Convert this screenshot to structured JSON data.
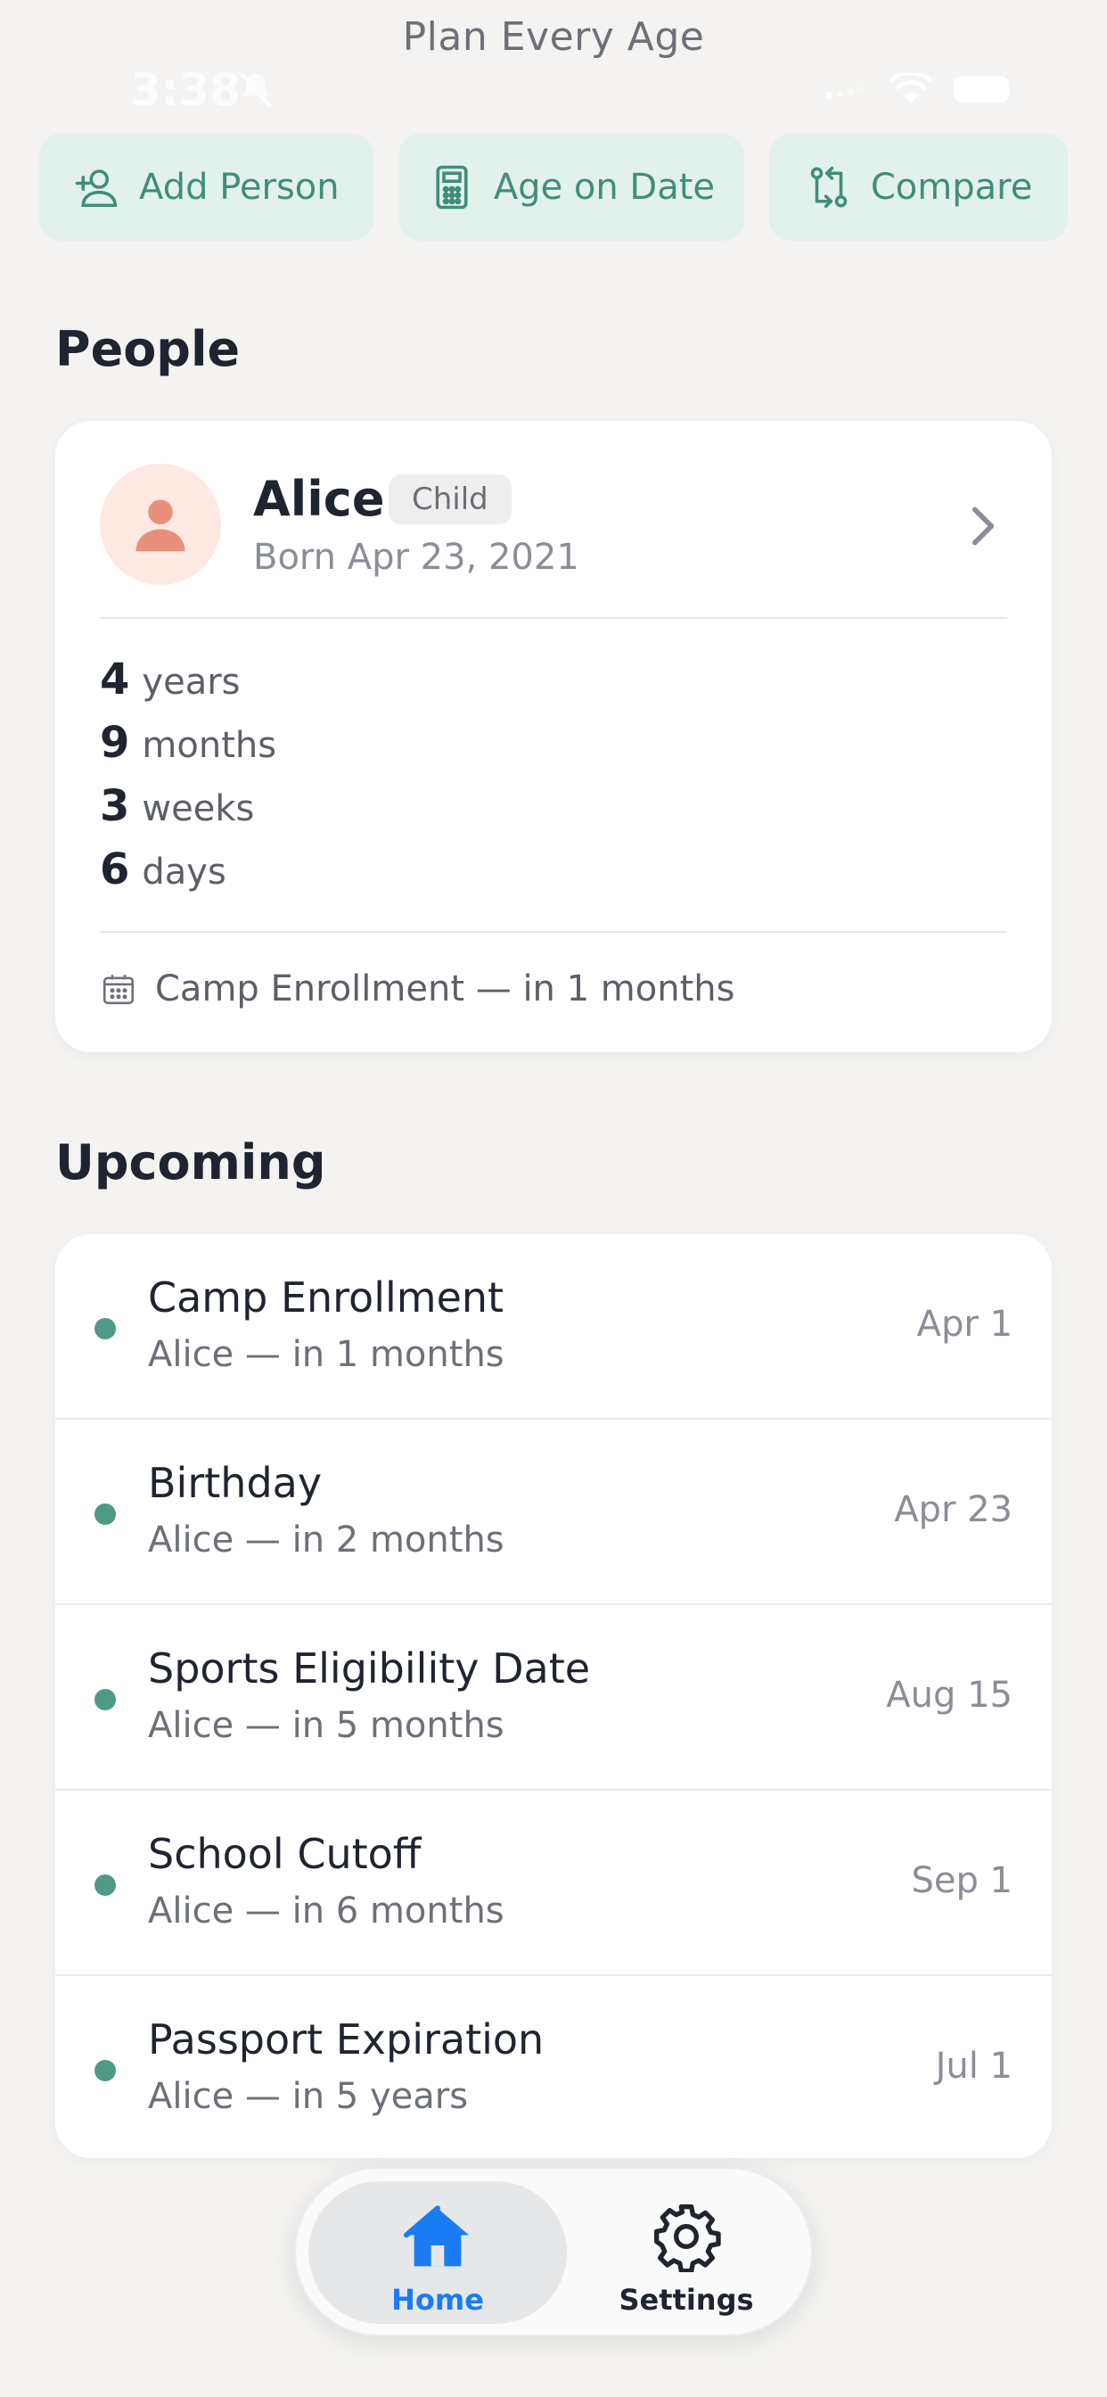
{
  "header": {
    "subtitle": "Plan Every Age"
  },
  "status_bar": {
    "time": "3:38"
  },
  "actions": [
    {
      "label": "Add Person",
      "icon": "add-person-icon"
    },
    {
      "label": "Age on Date",
      "icon": "calculator-icon"
    },
    {
      "label": "Compare",
      "icon": "compare-icon"
    }
  ],
  "people": {
    "section_title": "People",
    "person": {
      "name": "Alice",
      "badge": "Child",
      "born": "Born Apr 23, 2021",
      "age": [
        {
          "value": "4",
          "unit": "years"
        },
        {
          "value": "9",
          "unit": "months"
        },
        {
          "value": "3",
          "unit": "weeks"
        },
        {
          "value": "6",
          "unit": "days"
        }
      ],
      "next_event": "Camp Enrollment — in 1 months"
    }
  },
  "upcoming": {
    "section_title": "Upcoming",
    "events": [
      {
        "title": "Camp Enrollment",
        "subtitle": "Alice — in 1 months",
        "date": "Apr 1"
      },
      {
        "title": "Birthday",
        "subtitle": "Alice — in 2 months",
        "date": "Apr 23"
      },
      {
        "title": "Sports Eligibility Date",
        "subtitle": "Alice — in 5 months",
        "date": "Aug 15"
      },
      {
        "title": "School Cutoff",
        "subtitle": "Alice — in 6 months",
        "date": "Sep 1"
      },
      {
        "title": "Passport Expiration",
        "subtitle": "Alice — in 5 years",
        "date": "Jul 1"
      }
    ]
  },
  "tabbar": {
    "home_label": "Home",
    "settings_label": "Settings"
  },
  "colors": {
    "accent": "#3f8e7b",
    "accent_bg": "#e3f1ec",
    "tab_active": "#1a7cf5",
    "avatar_bg": "#fde8e2",
    "avatar_fg": "#e8907c"
  }
}
